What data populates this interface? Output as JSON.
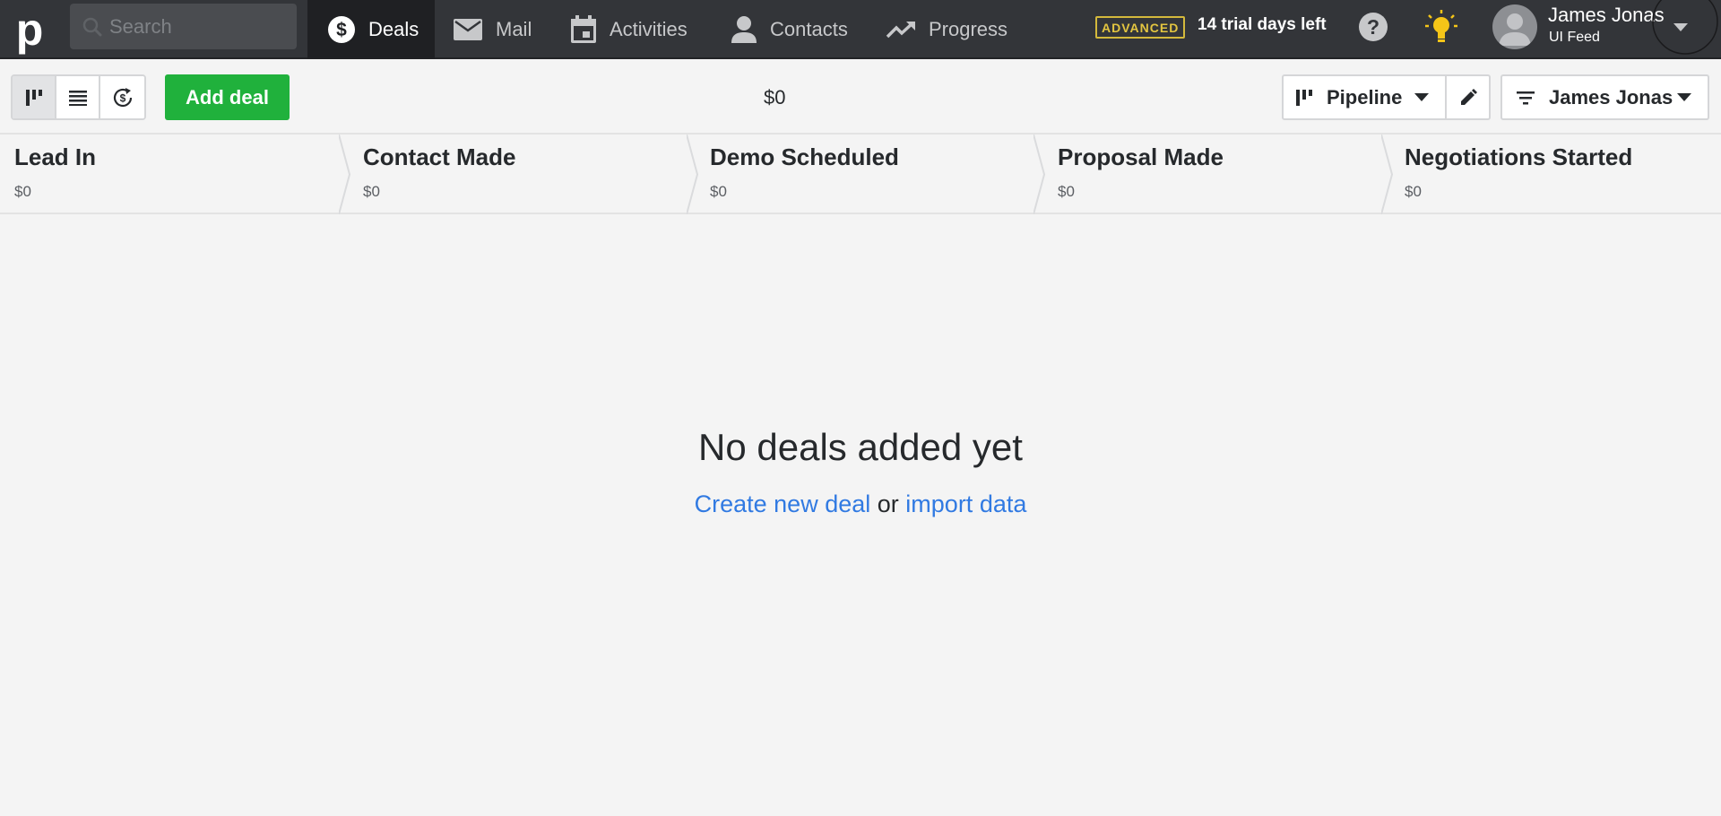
{
  "app": {
    "logo_letter": "p"
  },
  "search": {
    "placeholder": "Search"
  },
  "nav": {
    "deals": "Deals",
    "mail": "Mail",
    "activities": "Activities",
    "contacts": "Contacts",
    "progress": "Progress"
  },
  "plan": {
    "badge": "ADVANCED",
    "trial": "14 trial days left"
  },
  "user": {
    "name": "James Jonas",
    "company": "UI Feed"
  },
  "toolbar": {
    "add_deal": "Add deal",
    "total": "$0",
    "pipeline": "Pipeline",
    "filter_owner": "James Jonas"
  },
  "stages": [
    {
      "name": "Lead In",
      "amount": "$0"
    },
    {
      "name": "Contact Made",
      "amount": "$0"
    },
    {
      "name": "Demo Scheduled",
      "amount": "$0"
    },
    {
      "name": "Proposal Made",
      "amount": "$0"
    },
    {
      "name": "Negotiations Started",
      "amount": "$0"
    }
  ],
  "empty": {
    "title": "No deals added yet",
    "create_link": "Create new deal",
    "or": "or",
    "import_link": "import data"
  },
  "colors": {
    "accent_green": "#20b13c",
    "link_blue": "#317ae2",
    "badge_yellow": "#e3c540",
    "topbar": "#333539"
  },
  "icons": {
    "logo": "pipedrive-p-icon",
    "search": "search-icon",
    "deals": "dollar-circle-icon",
    "mail": "mail-icon",
    "activities": "calendar-icon",
    "contacts": "person-icon",
    "progress": "trend-up-icon",
    "help": "question-circle-icon",
    "tips": "lightbulb-icon",
    "user_menu": "caret-down-icon"
  }
}
